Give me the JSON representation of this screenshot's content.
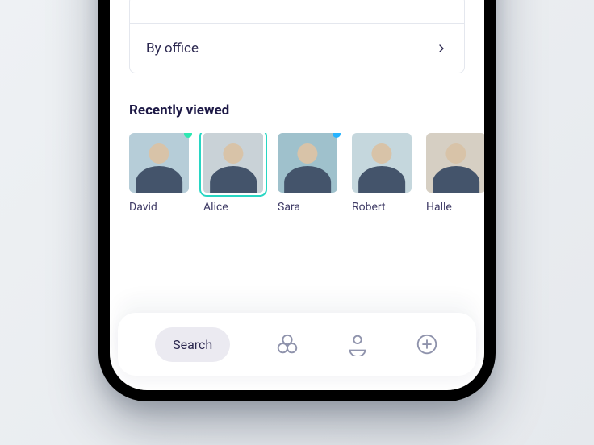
{
  "filters": {
    "by_office_label": "By office"
  },
  "recent": {
    "heading": "Recently viewed",
    "people": [
      {
        "name": "David",
        "status": "green",
        "selected": false
      },
      {
        "name": "Alice",
        "status": null,
        "selected": true
      },
      {
        "name": "Sara",
        "status": "blue",
        "selected": false
      },
      {
        "name": "Robert",
        "status": null,
        "selected": false
      },
      {
        "name": "Halle",
        "status": null,
        "selected": false
      }
    ]
  },
  "tabbar": {
    "search_label": "Search",
    "icons": {
      "groups": "groups-icon",
      "profile": "profile-icon",
      "add": "plus-icon"
    }
  }
}
